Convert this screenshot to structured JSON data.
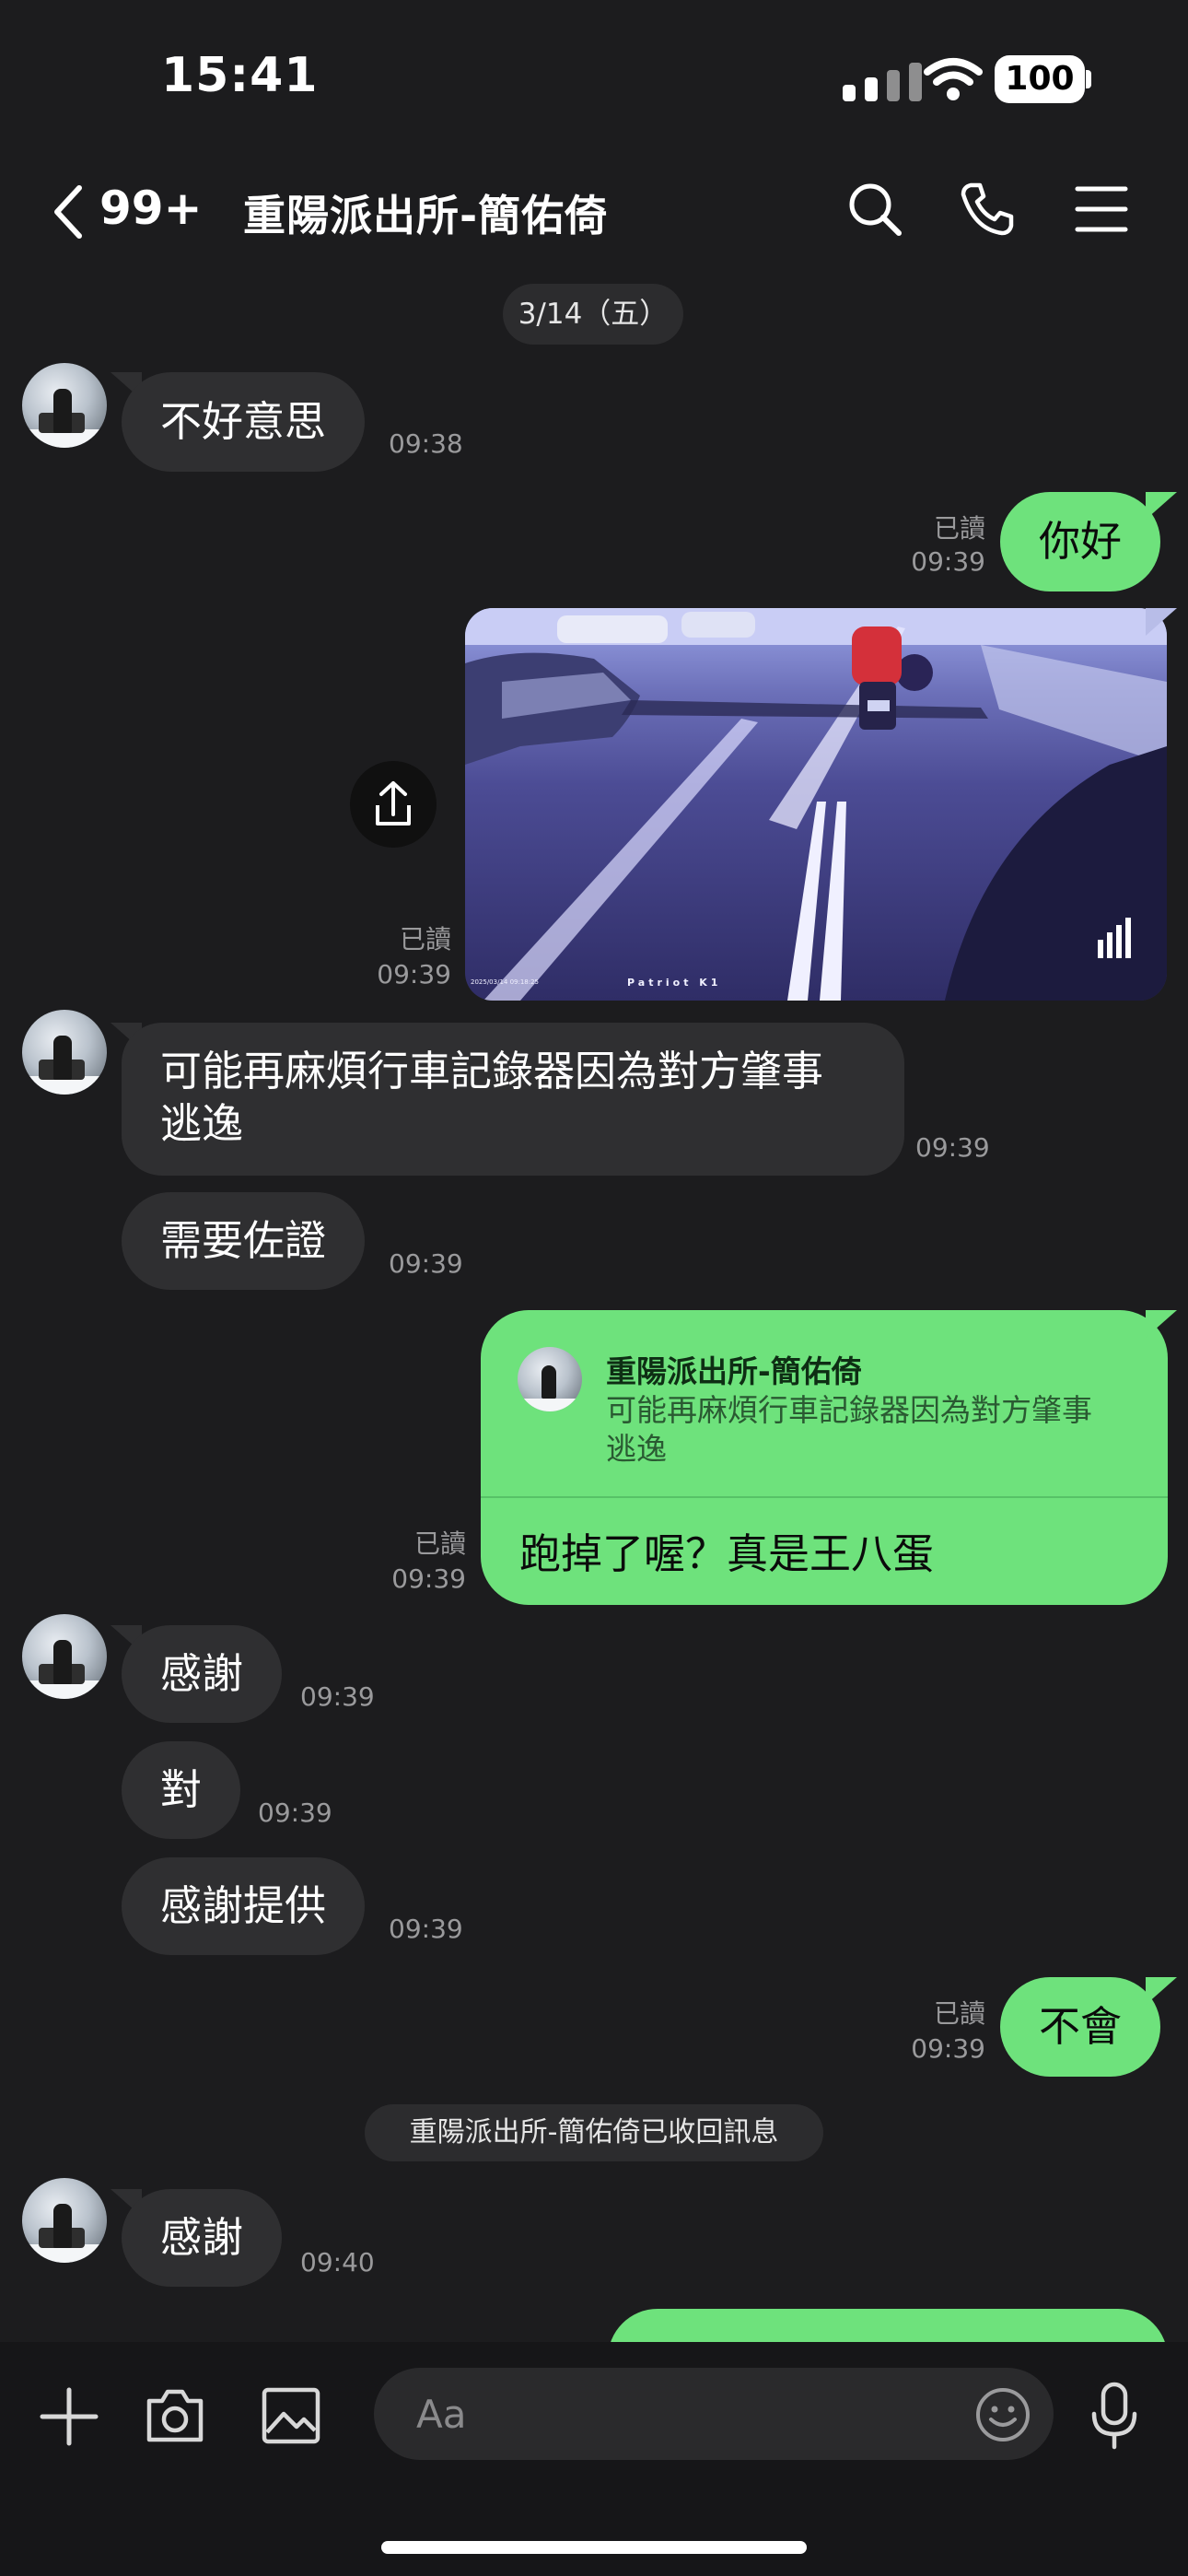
{
  "status_bar": {
    "time": "15:41",
    "battery": "100"
  },
  "header": {
    "unread_count": "99+",
    "title": "重陽派出所-簡佑倚"
  },
  "date_divider": "3/14（五）",
  "messages": {
    "m1": {
      "text": "不好意思",
      "time": "09:38"
    },
    "m2": {
      "text": "你好",
      "read": "已讀",
      "time": "09:39"
    },
    "m3": {
      "read": "已讀",
      "time": "09:39",
      "image_overlay": "Patriot K1",
      "image_timestamp": "2025/03/14  09:18:25"
    },
    "m4": {
      "line1": "可能再麻煩行車記錄器因為對方肇事",
      "line2": "逃逸",
      "time": "09:39"
    },
    "m5": {
      "text": "需要佐證",
      "time": "09:39"
    },
    "m6": {
      "quote_sender": "重陽派出所-簡佑倚",
      "quote_line1": "可能再麻煩行車記錄器因為對方肇事",
      "quote_line2": "逃逸",
      "text": "跑掉了喔？真是王八蛋",
      "read": "已讀",
      "time": "09:39"
    },
    "m7": {
      "text": "感謝",
      "time": "09:39"
    },
    "m8": {
      "text": "對",
      "time": "09:39"
    },
    "m9": {
      "text": "感謝提供",
      "time": "09:39"
    },
    "m10": {
      "text": "不會",
      "read": "已讀",
      "time": "09:39"
    },
    "system": "重陽派出所-簡佑倚已收回訊息",
    "m11": {
      "text": "感謝",
      "time": "09:40"
    }
  },
  "composer": {
    "placeholder": "Aa"
  },
  "colors": {
    "background": "#1c1c1e",
    "incoming": "#2f2f31",
    "outgoing": "#6ee27c"
  }
}
